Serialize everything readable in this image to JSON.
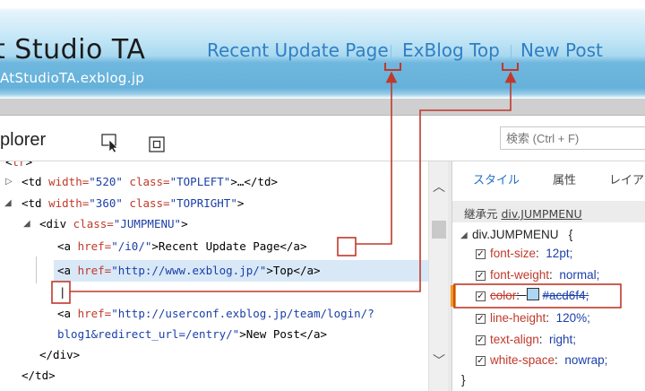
{
  "blog": {
    "title": "t Studio TA",
    "url": "AtStudioTA.exblog.jp",
    "links": [
      "Recent Update Page",
      "ExBlog Top",
      "New Post"
    ]
  },
  "devtools": {
    "title": "plorer",
    "find_placeholder": "検索 (Ctrl + F)"
  },
  "dom": {
    "lines": [
      {
        "prefix": "<",
        "name": "tr",
        "suffix": ">"
      },
      {
        "tag_open": "<td ",
        "a1n": "width=",
        "a1v": "\"520\"",
        "a2n": " class=",
        "a2v": "\"TOPLEFT\"",
        "tail": ">…</td>"
      },
      {
        "tag_open": "<td ",
        "a1n": "width=",
        "a1v": "\"360\"",
        "a2n": " class=",
        "a2v": "\"TOPRIGHT\"",
        "tail": ">"
      },
      {
        "tag_open": "<div ",
        "a1n": "class=",
        "a1v": "\"JUMPMENU\"",
        "tail": ">"
      },
      {
        "tag_open": "<a ",
        "a1n": "href=",
        "a1v": "\"/i0/\"",
        "tail": ">Recent Update Page</a>"
      },
      {
        "tag_open": "<a ",
        "a1n": "href=",
        "a1v": "\"http://www.exblog.jp/\"",
        "tail": ">Top</a>"
      },
      {
        "cursor": "|"
      },
      {
        "tag_open": "<a ",
        "a1n": "href=",
        "a1v": "\"http://userconf.exblog.jp/team/login/?"
      },
      {
        "a1v": "blog1&redirect_url=/entry/\"",
        "tail": ">New Post</a>"
      },
      {
        "tail": "</div>"
      },
      {
        "tail": "</td>"
      }
    ]
  },
  "styles": {
    "tabs": [
      "スタイル",
      "属性",
      "レイア"
    ],
    "inherited_label": "継承元",
    "inherited_from": "div.JUMPMENU",
    "selector": "div.JUMPMENU",
    "brace_open": "{",
    "brace_close": "}",
    "props": [
      {
        "name": "font-size",
        "value": "12pt;",
        "checked": true,
        "struck": false
      },
      {
        "name": "font-weight",
        "value": "normal;",
        "checked": true,
        "struck": false
      },
      {
        "name": "color",
        "value": "#acd6f4;",
        "checked": true,
        "struck": true,
        "swatch": "#acd6f4"
      },
      {
        "name": "line-height",
        "value": "120%;",
        "checked": true,
        "struck": false
      },
      {
        "name": "text-align",
        "value": "right;",
        "checked": true,
        "struck": false
      },
      {
        "name": "white-space",
        "value": "nowrap;",
        "checked": true,
        "struck": false
      }
    ]
  },
  "colors": {
    "link": "#2f7fc4",
    "annotation": "#c0392b",
    "selection": "#d8e8f7",
    "highlight": "#f19a1b"
  }
}
